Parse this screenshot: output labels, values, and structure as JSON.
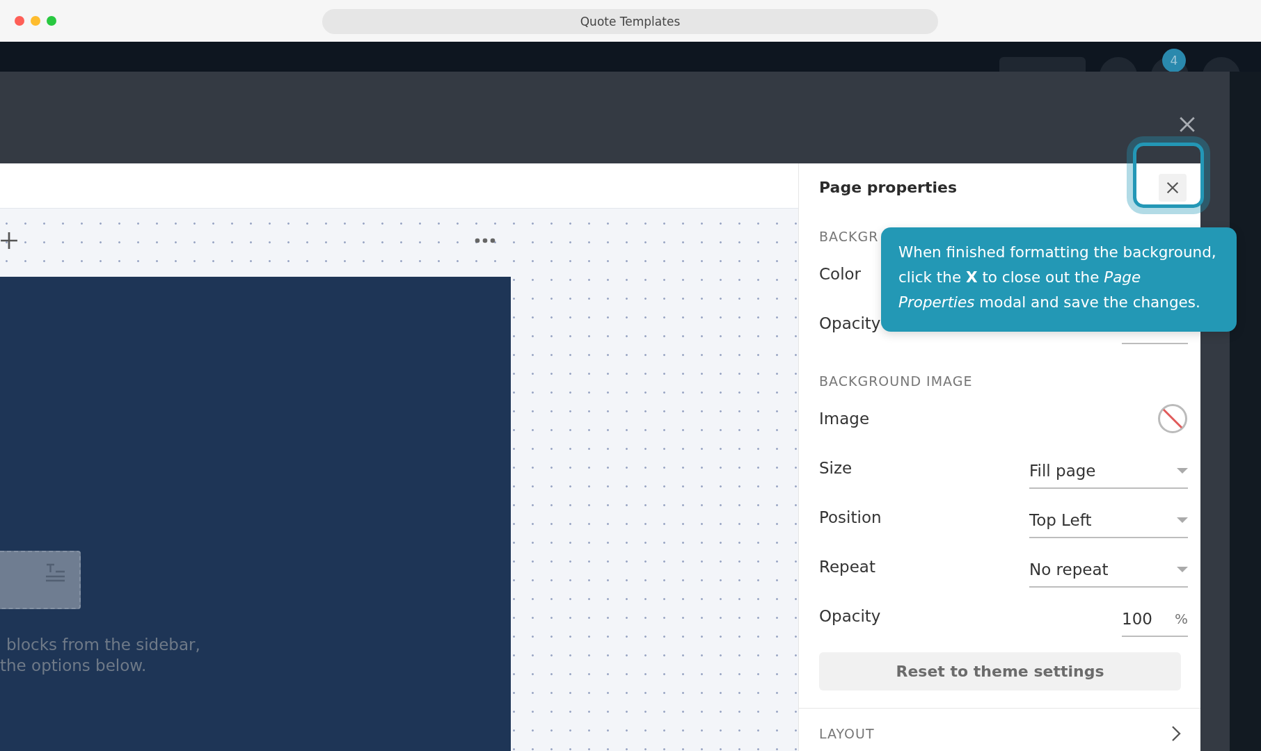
{
  "window": {
    "title": "Quote Templates"
  },
  "app_header": {
    "notification_badge": "4"
  },
  "canvas": {
    "hint_lines": [
      "blocks from the sidebar,",
      "the options below."
    ]
  },
  "panel": {
    "title": "Page properties",
    "sections": [
      {
        "heading": "BACKGR",
        "rows": [
          {
            "kind": "plain",
            "label": "Color"
          },
          {
            "kind": "number",
            "label": "Opacity"
          }
        ]
      },
      {
        "heading": "BACKGROUND IMAGE",
        "rows": [
          {
            "kind": "image-none",
            "label": "Image"
          },
          {
            "kind": "select",
            "label": "Size",
            "value": "Fill page"
          },
          {
            "kind": "select",
            "label": "Position",
            "value": "Top Left"
          },
          {
            "kind": "select",
            "label": "Repeat",
            "value": "No repeat"
          },
          {
            "kind": "number",
            "label": "Opacity",
            "value": "100",
            "unit": "%"
          }
        ]
      }
    ],
    "reset_button": "Reset to theme settings",
    "footer_section": "LAYOUT"
  },
  "tooltip": {
    "text": "When finished formatting the background, click the **X** to close out the *Page Properties* modal and save the changes."
  }
}
